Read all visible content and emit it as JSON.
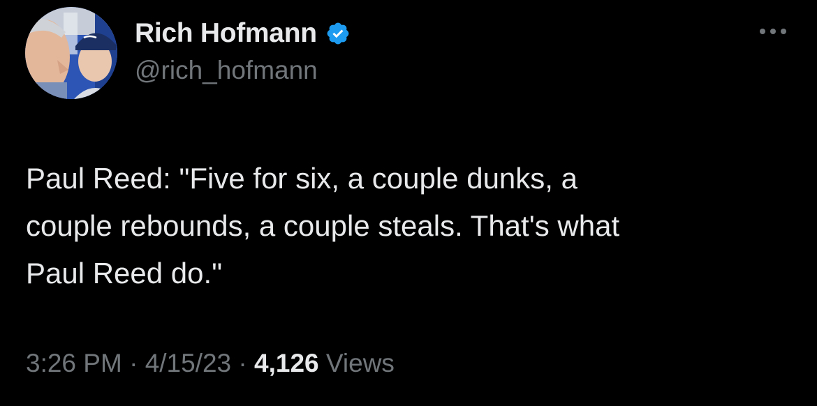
{
  "author": {
    "display_name": "Rich Hofmann",
    "handle": "@rich_hofmann",
    "verified": true,
    "avatar_icon": "profile-photo"
  },
  "tweet": {
    "text": "Paul Reed: \"Five for six, a couple dunks, a\ncouple rebounds, a couple steals. That's what\nPaul Reed do.\"",
    "time": "3:26 PM",
    "date": "4/15/23",
    "separator": "·",
    "views_count": "4,126",
    "views_label": "Views"
  },
  "colors": {
    "background": "#000000",
    "primary_text": "#e7e9ea",
    "secondary_text": "#71767b",
    "verified_badge": "#1d9bf0"
  },
  "icons": {
    "more": "more-horizontal-icon",
    "verified": "verified-badge-icon"
  }
}
